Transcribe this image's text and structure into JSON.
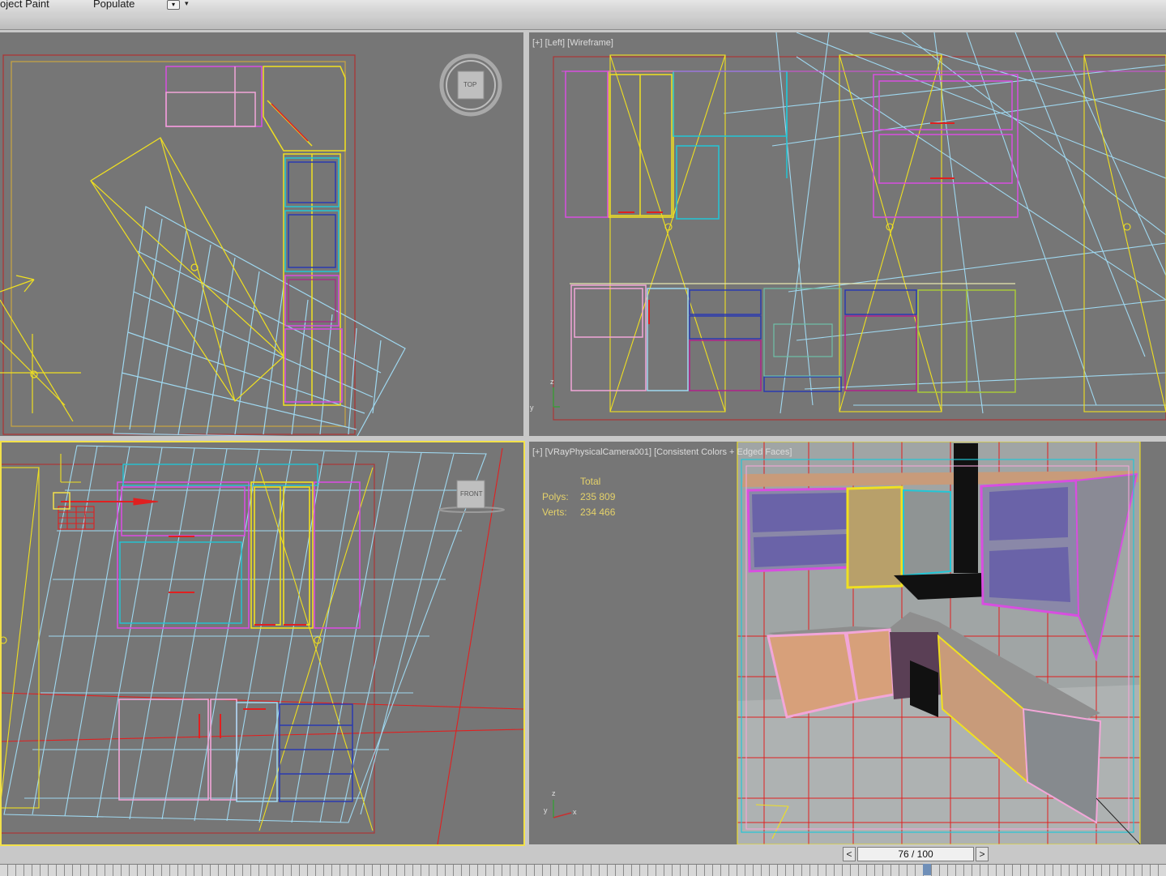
{
  "toolbar": {
    "object_paint_label": "oject Paint",
    "populate_label": "Populate"
  },
  "viewports": {
    "top": {
      "navcube_label": "TOP"
    },
    "left": {
      "label_plus": "[+]",
      "label_view": "[Left]",
      "label_shading": "[Wireframe]"
    },
    "front": {
      "navcube_label": "FRONT"
    },
    "camera": {
      "label_plus": "[+]",
      "label_view": "[VRayPhysicalCamera001]",
      "label_shading": "[Consistent Colors + Edged Faces]",
      "stats": {
        "header": "Total",
        "polys_label": "Polys:",
        "polys_value": "235 809",
        "verts_label": "Verts:",
        "verts_value": "234 466"
      }
    }
  },
  "axis": {
    "x": "x",
    "y": "y",
    "z": "z"
  },
  "time_slider": {
    "prev": "<",
    "next": ">",
    "frame_text": "76 / 100",
    "frame": 76,
    "total": 100
  },
  "colors": {
    "viewport_bg": "#767676",
    "active_border": "#f2e14a",
    "stats_text": "#e5d26a",
    "wire_yellow": "#f0e020",
    "wire_pink": "#f2a6d8",
    "wire_magenta": "#d84ee0",
    "wire_cyan": "#22c6d6",
    "wire_lightblue": "#9fd8f0",
    "wire_red": "#e02020"
  }
}
